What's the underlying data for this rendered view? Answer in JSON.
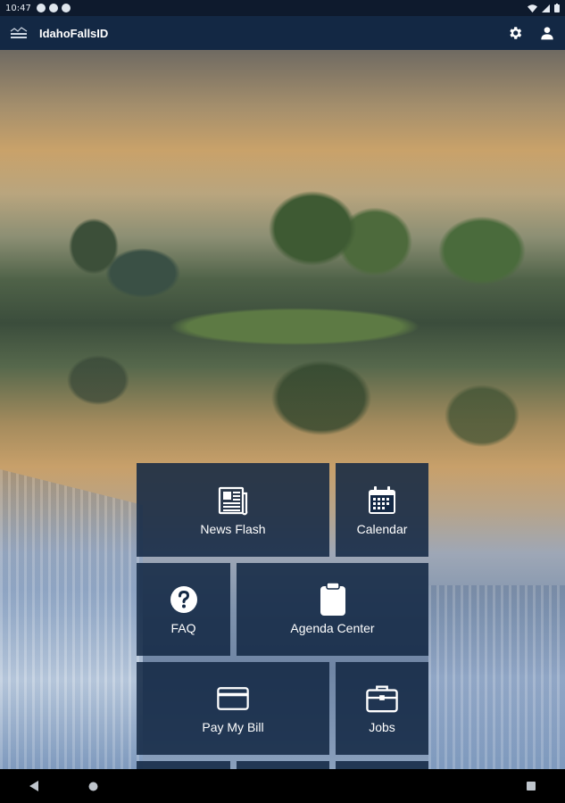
{
  "status_bar": {
    "time": "10:47",
    "notification_icons": [
      "notification-icon",
      "notification-icon",
      "notification-icon"
    ],
    "right_icons": [
      "wifi-icon",
      "signal-icon",
      "battery-icon"
    ]
  },
  "app_bar": {
    "title": "IdahoFallsID",
    "logo_icon": "city-logo-icon",
    "settings_icon": "gear-icon",
    "account_icon": "person-icon",
    "color": "#132844"
  },
  "tiles": [
    {
      "label": "News Flash",
      "icon": "newspaper-icon"
    },
    {
      "label": "Calendar",
      "icon": "calendar-icon"
    },
    {
      "label": "FAQ",
      "icon": "question-icon"
    },
    {
      "label": "Agenda Center",
      "icon": "clipboard-icon"
    },
    {
      "label": "Pay My Bill",
      "icon": "credit-card-icon"
    },
    {
      "label": "Jobs",
      "icon": "briefcase-icon"
    }
  ],
  "nav_bar": {
    "back_icon": "back-triangle-icon",
    "home_icon": "home-circle-icon",
    "recents_icon": "recents-square-icon"
  },
  "colors": {
    "tile_background": "#112642",
    "status_bar": "#0e1a2d"
  }
}
